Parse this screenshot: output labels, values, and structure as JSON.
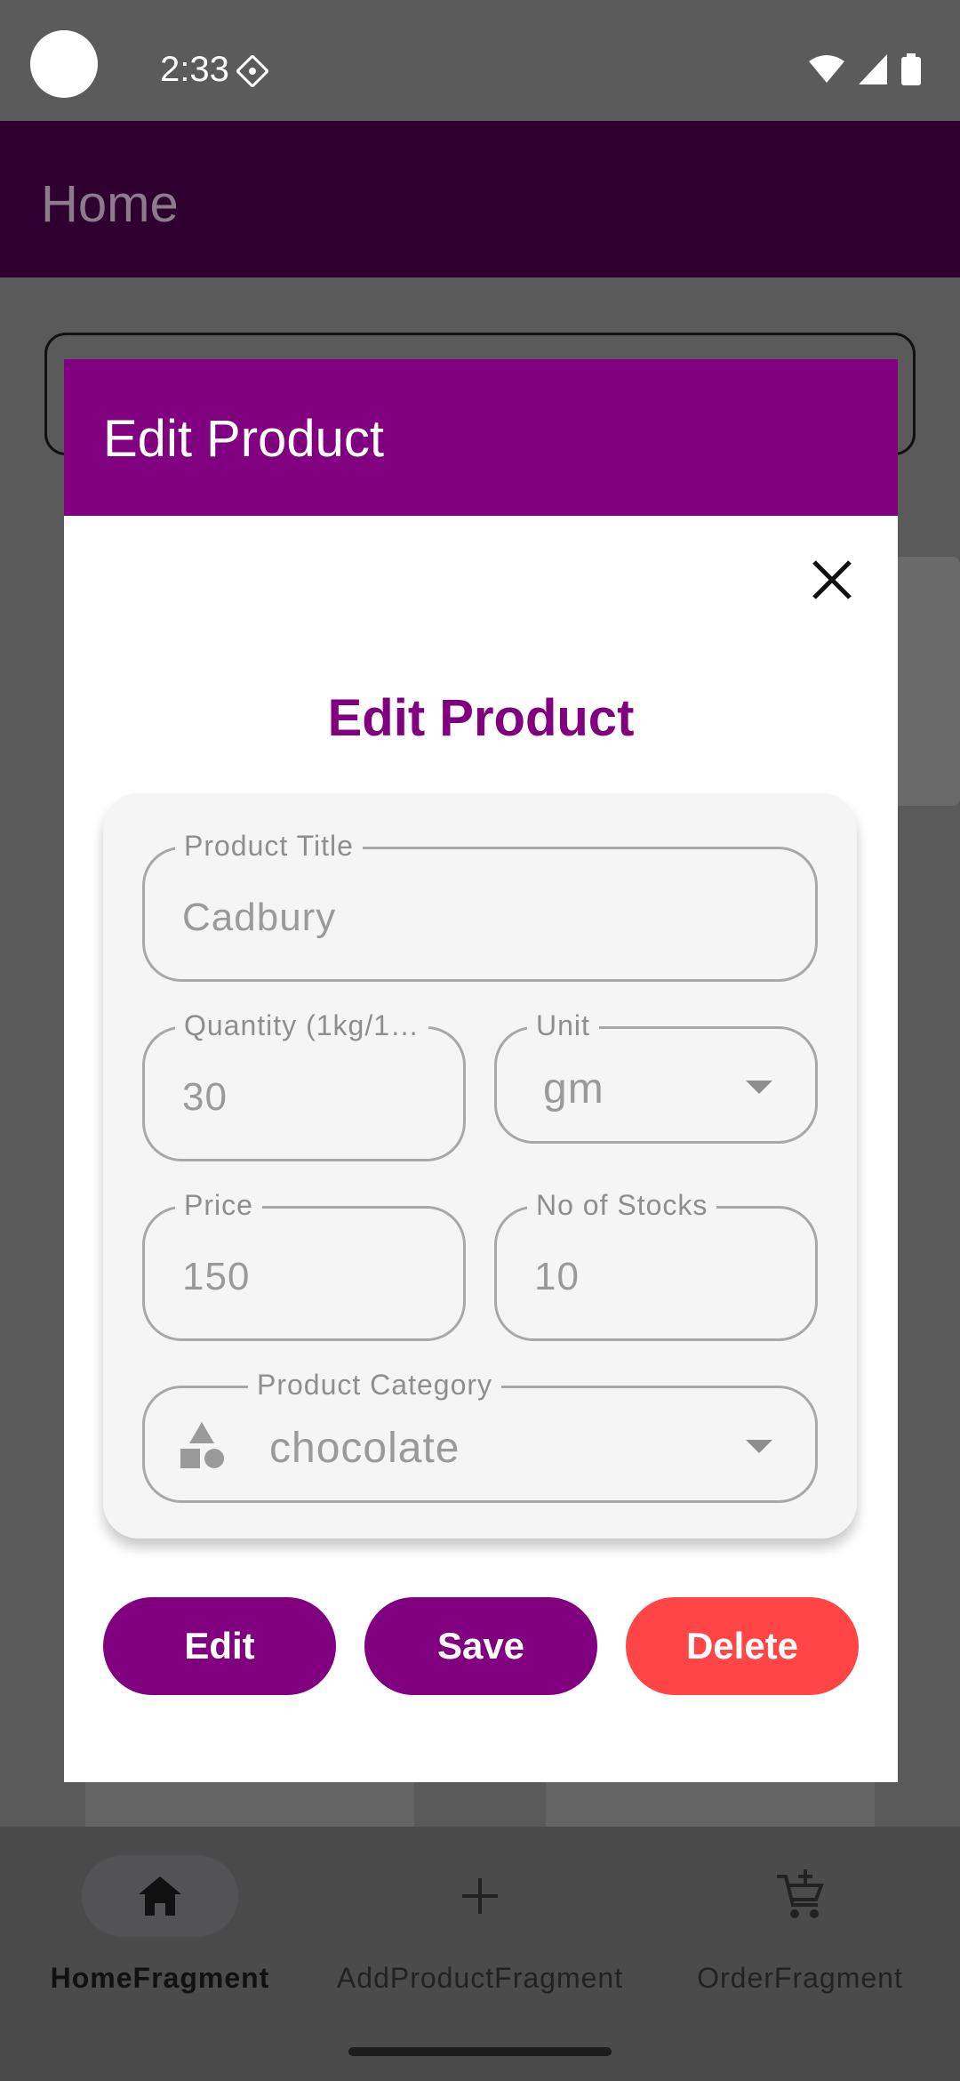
{
  "status_bar": {
    "time": "2:33"
  },
  "app_bar": {
    "title": "Home"
  },
  "dialog": {
    "header_title": "Edit Product",
    "form_heading": "Edit Product",
    "fields": {
      "product_title": {
        "label": "Product Title",
        "value": "Cadbury"
      },
      "quantity": {
        "label": "Quantity (1kg/1…",
        "value": "30"
      },
      "unit": {
        "label": "Unit",
        "value": "gm"
      },
      "price": {
        "label": "Price",
        "value": "150"
      },
      "stocks": {
        "label": "No of Stocks",
        "value": "10"
      },
      "category": {
        "label": "Product Category",
        "value": "chocolate"
      }
    },
    "buttons": {
      "edit": "Edit",
      "save": "Save",
      "delete": "Delete"
    }
  },
  "bottom_nav": {
    "items": [
      {
        "label": "HomeFragment",
        "icon": "home-icon",
        "active": true
      },
      {
        "label": "AddProductFragment",
        "icon": "plus-icon",
        "active": false
      },
      {
        "label": "OrderFragment",
        "icon": "cart-add-icon",
        "active": false
      }
    ]
  },
  "colors": {
    "primary": "#800080",
    "delete": "#ff4545",
    "app_bar": "#2e0030"
  }
}
